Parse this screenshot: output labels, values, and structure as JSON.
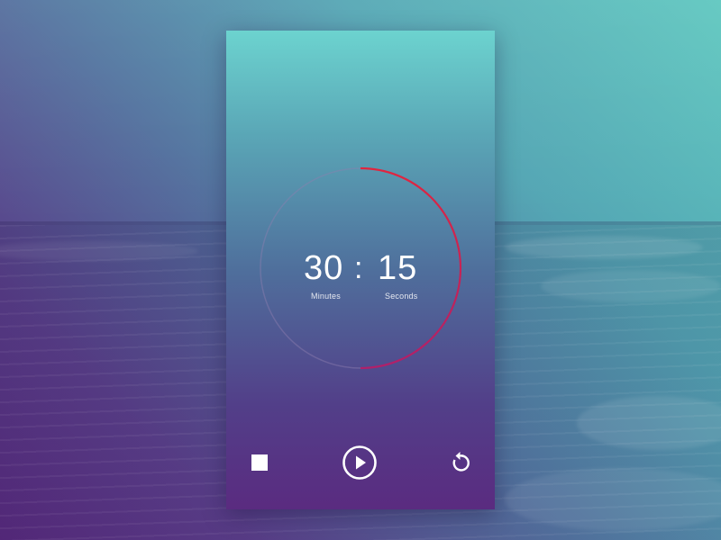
{
  "timer": {
    "minutes": "30",
    "separator": ":",
    "seconds": "15",
    "minutes_label": "Minutes",
    "seconds_label": "Seconds",
    "progress_fraction": 0.5
  },
  "controls": {
    "stop_icon": "stop-icon",
    "play_icon": "play-circle-icon",
    "replay_icon": "replay-icon"
  },
  "colors": {
    "progress_start": "#e0253f",
    "progress_end": "#b0206a",
    "track": "#8f7fb0",
    "text": "#ffffff"
  }
}
